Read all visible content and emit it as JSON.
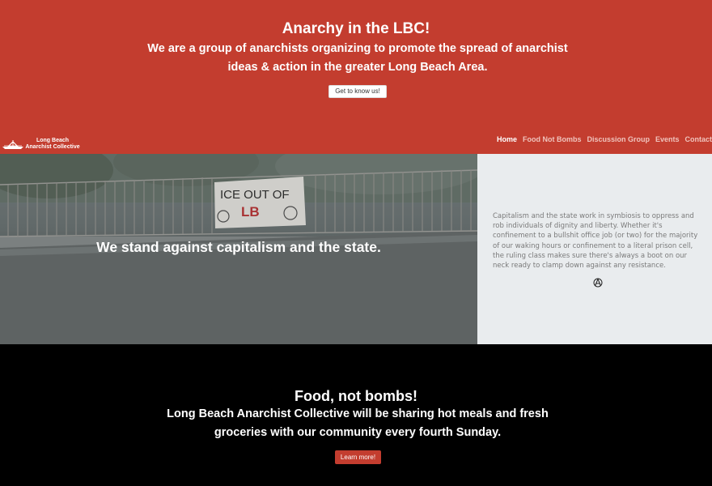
{
  "hero": {
    "title": "Anarchy in the LBC!",
    "subtitle": "We are a group of anarchists organizing to promote the spread of anarchist ideas & action in the greater Long Beach Area.",
    "button_label": "Get to know us!",
    "background_color": "#c33d2f"
  },
  "nav": {
    "logo_line1": "Long Beach",
    "logo_line2": "Anarchist Collective",
    "items": [
      {
        "label": "Home",
        "active": true
      },
      {
        "label": "Food Not Bombs",
        "active": false
      },
      {
        "label": "Discussion Group",
        "active": false
      },
      {
        "label": "Events",
        "active": false
      },
      {
        "label": "Contact",
        "active": false
      }
    ]
  },
  "banner": {
    "photo_banner_text_1": "ICE OUT OF",
    "photo_banner_text_2": "LB",
    "headline": "We stand against capitalism and the state."
  },
  "side": {
    "paragraph": "Capitalism and the state work in symbiosis to oppress and rob individuals of dignity and liberty. Whether it's confinement to a bullshit office job (or two) for the majority of our waking hours or confinement to a literal prison cell, the ruling class makes sure there's always a boot on our neck ready to clamp down against any resistance.",
    "icon": "anarchy-a-icon"
  },
  "food": {
    "title": "Food, not bombs!",
    "subtitle": "Long Beach Anarchist Collective will be sharing hot meals and fresh groceries with our community every fourth Sunday.",
    "button_label": "Learn more!"
  }
}
